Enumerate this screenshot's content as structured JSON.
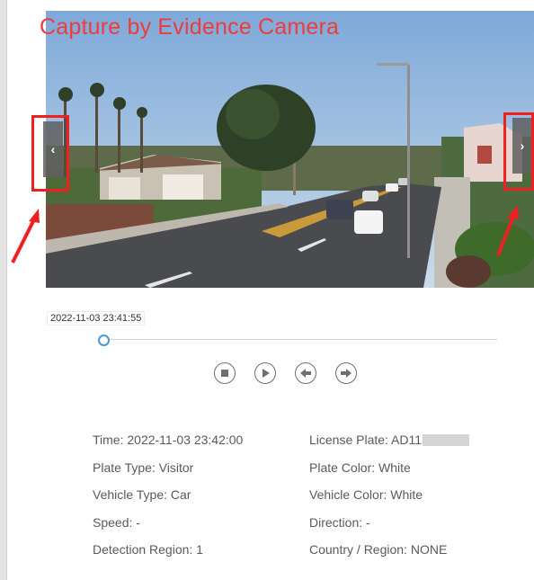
{
  "overlay": {
    "title": "Capture by Evidence Camera"
  },
  "player": {
    "prev_icon": "chevron-left-icon",
    "next_icon": "chevron-right-icon",
    "prev_glyph": "‹",
    "next_glyph": "›",
    "timestamp": "2022-11-03 23:41:55",
    "progress": 0.0
  },
  "controls": [
    {
      "name": "stop-icon"
    },
    {
      "name": "play-icon"
    },
    {
      "name": "rewind-icon"
    },
    {
      "name": "forward-icon"
    }
  ],
  "details": {
    "time": "Time: 2022-11-03 23:42:00",
    "license_plate": "License Plate: AD11",
    "plate_type": "Plate Type: Visitor",
    "plate_color": "Plate Color: White",
    "vehicle_type": "Vehicle Type: Car",
    "vehicle_color": "Vehicle Color: White",
    "speed": "Speed: -",
    "direction": "Direction: -",
    "detection_region": "Detection Region: 1",
    "country_region": "Country / Region: NONE"
  },
  "colors": {
    "annotation_red": "#ee2020",
    "accent_blue": "#4b97d6"
  }
}
